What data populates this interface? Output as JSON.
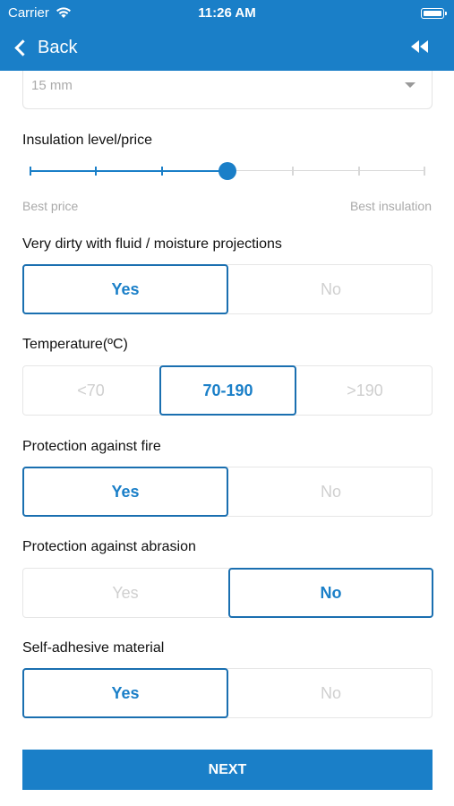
{
  "status_bar": {
    "carrier": "Carrier",
    "time": "11:26 AM"
  },
  "nav": {
    "back_label": "Back",
    "rewind_icon": "rewind-icon"
  },
  "thickness_select": {
    "value": "15 mm"
  },
  "insulation": {
    "label": "Insulation level/price",
    "min_caption": "Best price",
    "max_caption": "Best insulation",
    "steps": 7,
    "selected_step": 4
  },
  "questions": [
    {
      "label": "Very dirty with fluid / moisture projections",
      "options": [
        "Yes",
        "No"
      ],
      "selected": 0
    },
    {
      "label": "Temperature(ºC)",
      "options": [
        "<70",
        "70-190",
        ">190"
      ],
      "selected": 1
    },
    {
      "label": "Protection against fire",
      "options": [
        "Yes",
        "No"
      ],
      "selected": 0
    },
    {
      "label": "Protection against abrasion",
      "options": [
        "Yes",
        "No"
      ],
      "selected": 1
    },
    {
      "label": "Self-adhesive material",
      "options": [
        "Yes",
        "No"
      ],
      "selected": 0
    }
  ],
  "next_label": "NEXT",
  "colors": {
    "accent": "#1a7fc8",
    "border_selected": "#1a6fb0",
    "muted": "#cfcfcf"
  }
}
